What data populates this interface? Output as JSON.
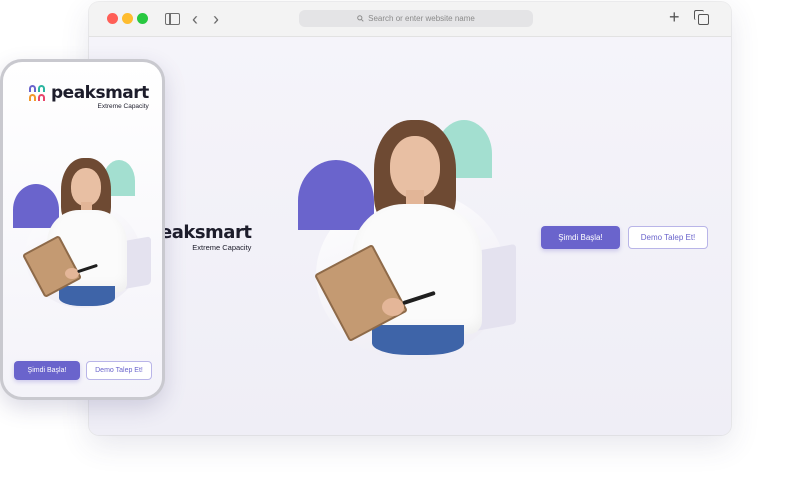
{
  "browser": {
    "address_placeholder": "Search or enter website name",
    "icons": [
      "sidebar-icon",
      "back-chevron-icon",
      "forward-chevron-icon",
      "search-icon",
      "plus-icon",
      "tabs-icon"
    ]
  },
  "brand": {
    "name_desktop": "eaksmart",
    "name_phone": "peaksmart",
    "tagline": "Extreme Capacity"
  },
  "cta": {
    "primary": "Şimdi Başla!",
    "secondary": "Demo Talep Et!"
  },
  "colors": {
    "accent": "#6a64cc",
    "teal": "#a3dfd0",
    "background": "#f3f2f8"
  }
}
